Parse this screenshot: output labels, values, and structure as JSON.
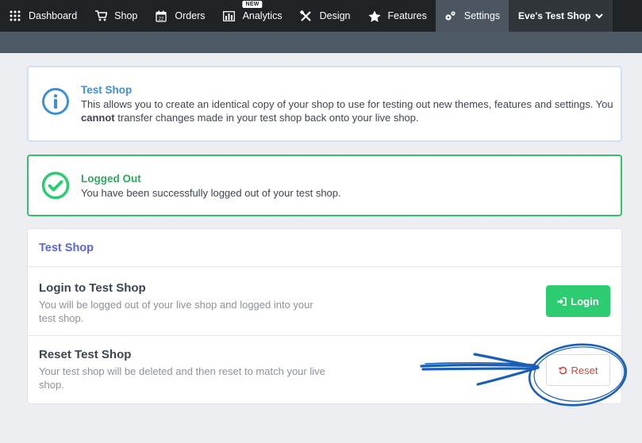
{
  "nav": {
    "items": [
      {
        "label": "Dashboard",
        "icon": "grid-icon"
      },
      {
        "label": "Shop",
        "icon": "shop-icon"
      },
      {
        "label": "Orders",
        "icon": "calendar-icon"
      },
      {
        "label": "Analytics",
        "icon": "bar-chart-icon",
        "badge": "NEW"
      },
      {
        "label": "Design",
        "icon": "design-tools-icon"
      },
      {
        "label": "Features",
        "icon": "star-icon"
      },
      {
        "label": "Settings",
        "icon": "gears-icon"
      }
    ],
    "shop_name": "Eve's Test Shop"
  },
  "info_alert": {
    "title": "Test Shop",
    "text_before": "This allows you to create an identical copy of your shop to use for testing out new themes, features and settings. You ",
    "text_bold": "cannot",
    "text_after": " transfer changes made in your test shop back onto your live shop."
  },
  "success_alert": {
    "title": "Logged Out",
    "text": "You have been successfully logged out of your test shop."
  },
  "panel": {
    "title": "Test Shop",
    "login": {
      "title": "Login to Test Shop",
      "desc": "You will be logged out of your live shop and logged into your test shop.",
      "button": "Login"
    },
    "reset": {
      "title": "Reset Test Shop",
      "desc": "Your test shop will be deleted and then reset to match your live shop.",
      "button": "Reset"
    }
  },
  "colors": {
    "nav_bg": "#1f2326",
    "nav_active": "#4b5661",
    "info": "#3d8fd6",
    "success": "#2ecc71",
    "danger": "#d9453a",
    "annotation": "#1a5fb4"
  }
}
